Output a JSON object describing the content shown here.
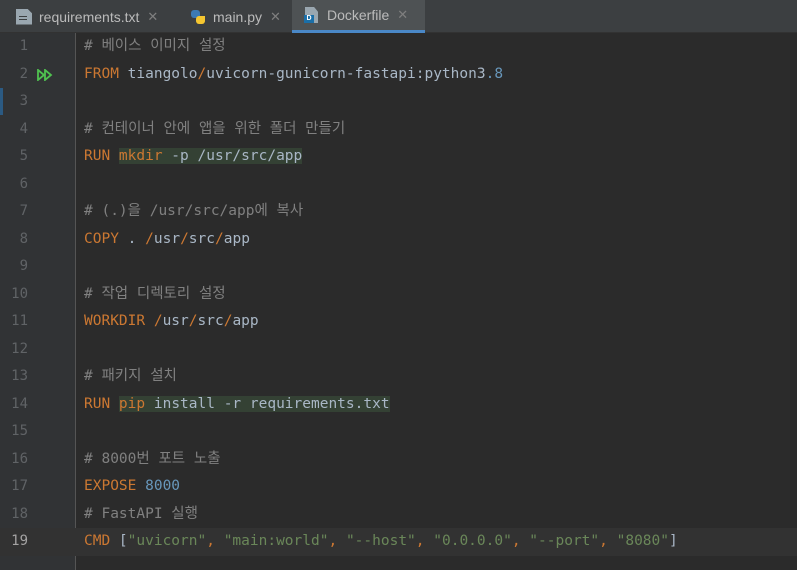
{
  "tabs": [
    {
      "label": "requirements.txt",
      "icon": "text-file-icon",
      "active": false
    },
    {
      "label": "main.py",
      "icon": "python-file-icon",
      "active": false
    },
    {
      "label": "Dockerfile",
      "icon": "dockerfile-icon",
      "active": true
    }
  ],
  "close_glyph": "✕",
  "docker_badge": "D",
  "current_line": 19,
  "lines": [
    {
      "n": "1",
      "tokens": [
        {
          "t": "# 베이스 이미지 설정",
          "c": "cm"
        }
      ]
    },
    {
      "n": "2",
      "run": true,
      "tokens": [
        {
          "t": "FROM ",
          "c": "kw"
        },
        {
          "t": "tiangolo",
          "c": "tx"
        },
        {
          "t": "/",
          "c": "kw"
        },
        {
          "t": "uvicorn-gunicorn-fastapi:python3",
          "c": "tx"
        },
        {
          "t": ".8",
          "c": "num-lit"
        }
      ]
    },
    {
      "n": "3",
      "tokens": []
    },
    {
      "n": "4",
      "tokens": [
        {
          "t": "# 컨테이너 안에 앱을 위한 폴더 만들기",
          "c": "cm"
        }
      ]
    },
    {
      "n": "5",
      "tokens": [
        {
          "t": "RUN ",
          "c": "kw"
        },
        {
          "t": "mkdir",
          "c": "kw hl"
        },
        {
          "t": " -p /usr/src/app",
          "c": "tx hl"
        }
      ]
    },
    {
      "n": "6",
      "tokens": []
    },
    {
      "n": "7",
      "tokens": [
        {
          "t": "# (.)을 /usr/src/app에 복사",
          "c": "cm"
        }
      ]
    },
    {
      "n": "8",
      "tokens": [
        {
          "t": "COPY ",
          "c": "kw"
        },
        {
          "t": ". ",
          "c": "tx"
        },
        {
          "t": "/",
          "c": "kw"
        },
        {
          "t": "usr",
          "c": "tx"
        },
        {
          "t": "/",
          "c": "kw"
        },
        {
          "t": "src",
          "c": "tx"
        },
        {
          "t": "/",
          "c": "kw"
        },
        {
          "t": "app",
          "c": "tx"
        }
      ]
    },
    {
      "n": "9",
      "tokens": []
    },
    {
      "n": "10",
      "tokens": [
        {
          "t": "# 작업 디렉토리 설정",
          "c": "cm"
        }
      ]
    },
    {
      "n": "11",
      "tokens": [
        {
          "t": "WORKDIR ",
          "c": "kw"
        },
        {
          "t": "/",
          "c": "kw"
        },
        {
          "t": "usr",
          "c": "tx"
        },
        {
          "t": "/",
          "c": "kw"
        },
        {
          "t": "src",
          "c": "tx"
        },
        {
          "t": "/",
          "c": "kw"
        },
        {
          "t": "app",
          "c": "tx"
        }
      ]
    },
    {
      "n": "12",
      "tokens": []
    },
    {
      "n": "13",
      "tokens": [
        {
          "t": "# 패키지 설치",
          "c": "cm"
        }
      ]
    },
    {
      "n": "14",
      "tokens": [
        {
          "t": "RUN ",
          "c": "kw"
        },
        {
          "t": "pip",
          "c": "kw hl"
        },
        {
          "t": " install -r requirements.txt",
          "c": "tx hl"
        }
      ]
    },
    {
      "n": "15",
      "tokens": []
    },
    {
      "n": "16",
      "tokens": [
        {
          "t": "# 8000번 포트 노출",
          "c": "cm"
        }
      ]
    },
    {
      "n": "17",
      "tokens": [
        {
          "t": "EXPOSE ",
          "c": "kw"
        },
        {
          "t": "8000",
          "c": "num-lit"
        }
      ]
    },
    {
      "n": "18",
      "tokens": [
        {
          "t": "# FastAPI 실행",
          "c": "cm"
        }
      ]
    },
    {
      "n": "19",
      "tokens": [
        {
          "t": "CMD ",
          "c": "kw"
        },
        {
          "t": "[",
          "c": "tx"
        },
        {
          "t": "\"uvicorn\"",
          "c": "str"
        },
        {
          "t": ", ",
          "c": "kw"
        },
        {
          "t": "\"main:world\"",
          "c": "str"
        },
        {
          "t": ", ",
          "c": "kw"
        },
        {
          "t": "\"--host\"",
          "c": "str"
        },
        {
          "t": ", ",
          "c": "kw"
        },
        {
          "t": "\"0.0.0.0\"",
          "c": "str"
        },
        {
          "t": ", ",
          "c": "kw"
        },
        {
          "t": "\"--port\"",
          "c": "str"
        },
        {
          "t": ", ",
          "c": "kw"
        },
        {
          "t": "\"8080\"",
          "c": "str"
        },
        {
          "t": "]",
          "c": "tx"
        }
      ]
    }
  ],
  "colors": {
    "keyword": "#cc7832",
    "comment": "#808080",
    "number": "#6897bb",
    "string": "#6a8759",
    "text": "#a9b7c6",
    "background": "#2b2b2b",
    "run_icon": "#4fc14f"
  }
}
